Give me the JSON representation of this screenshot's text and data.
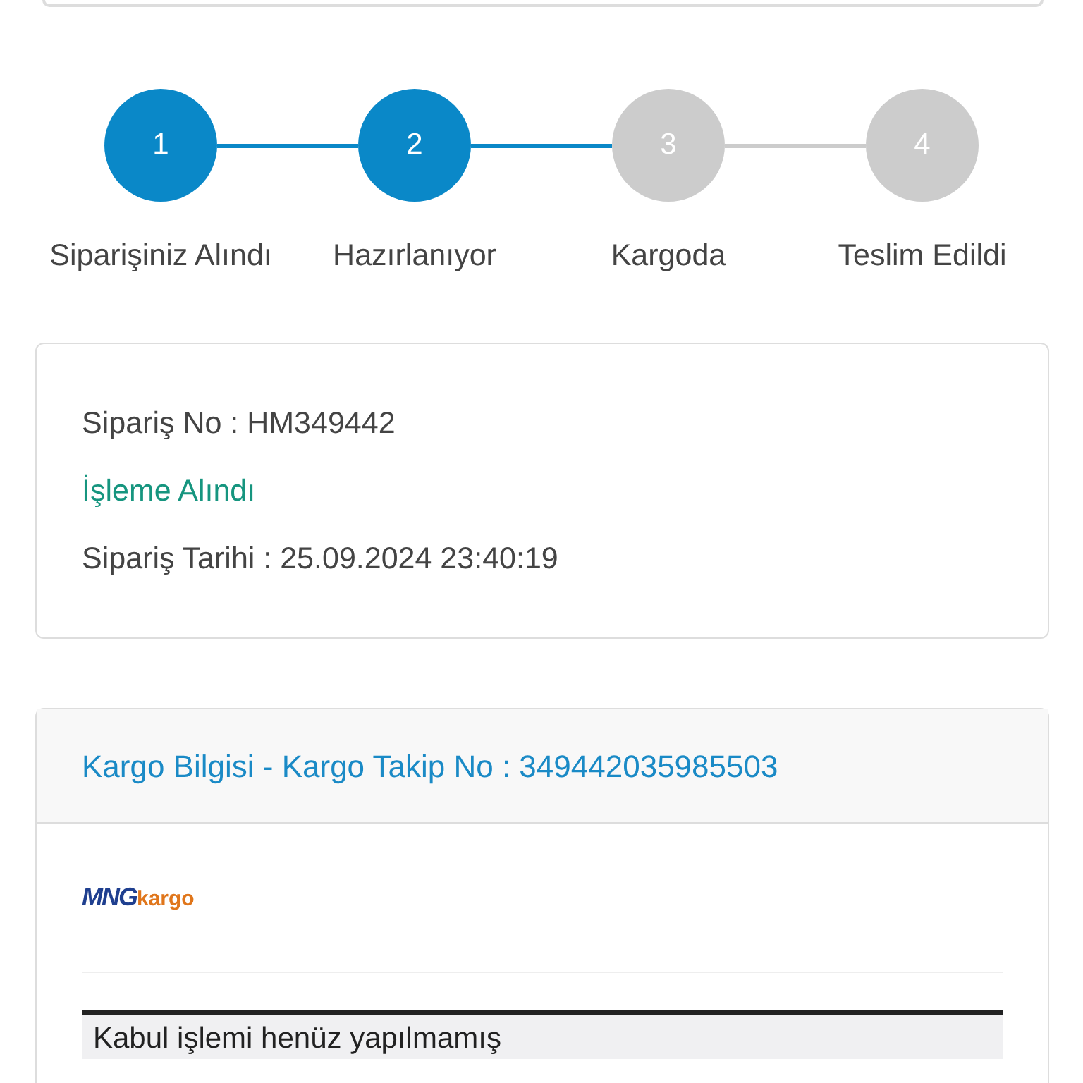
{
  "steps": [
    {
      "number": "1",
      "label": "Siparişiniz Alındı",
      "done": true
    },
    {
      "number": "2",
      "label": "Hazırlanıyor",
      "done": true
    },
    {
      "number": "3",
      "label": "Kargoda",
      "done": false
    },
    {
      "number": "4",
      "label": "Teslim Edildi",
      "done": false
    }
  ],
  "order": {
    "number_line": "Sipariş No : HM349442",
    "status": "İşleme Alındı",
    "date_line": "Sipariş Tarihi : 25.09.2024 23:40:19"
  },
  "shipping": {
    "title": "Kargo Bilgisi - Kargo Takip No : 349442035985503",
    "logo_main": "MNG",
    "logo_sub": "kargo",
    "message": "Kabul işlemi henüz yapılmamış"
  }
}
